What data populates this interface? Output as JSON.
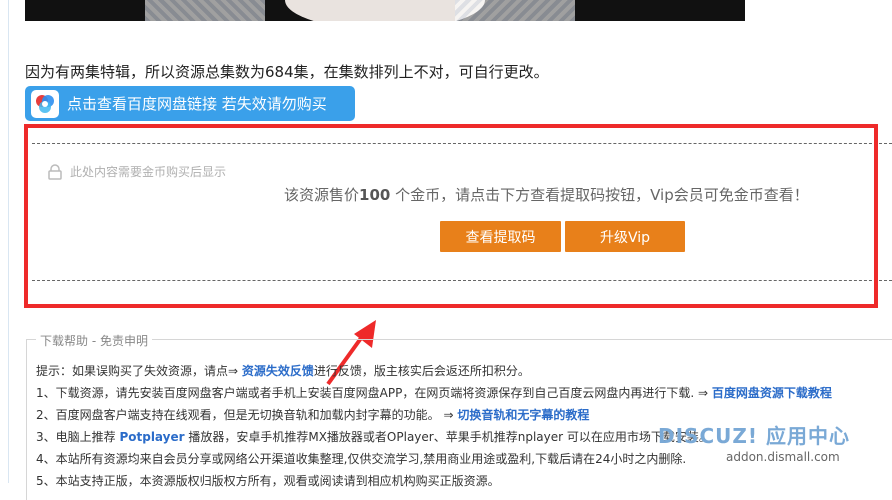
{
  "notice_text": "因为有两集特辑，所以资源总集数为684集，在集数排列上不对，可自行更改。",
  "pan_button": {
    "label": "点击查看百度网盘链接  若失效请勿购买"
  },
  "locked": {
    "hint": "此处内容需要金币购买后显示",
    "sale_prefix": "该资源售价",
    "price": "100",
    "sale_suffix": " 个金币，请点击下方查看提取码按钮，Vip会员可免金币查看！",
    "view_code_button": "查看提取码",
    "upgrade_vip_button": "升级Vip"
  },
  "help": {
    "legend": "下载帮助 - 免责申明",
    "lines": [
      {
        "pre": "提示：如果误购买了失效资源，请点⇒ ",
        "link": "资源失效反馈",
        "post": "进行反馈，版主核实后会返还所扣积分。"
      },
      {
        "pre": "1、下载资源，请先安装百度网盘客户端或者手机上安装百度网盘APP，在网页端将资源保存到自己百度云网盘内再进行下载. ⇒ ",
        "link": "百度网盘资源下载教程",
        "post": ""
      },
      {
        "pre": "2、百度网盘客户端支持在线观看，但是无切换音轨和加载内封字幕的功能。 ⇒ ",
        "link": "切换音轨和无字幕的教程",
        "post": ""
      },
      {
        "pre": "3、电脑上推荐 ",
        "link": "Potplayer",
        "post": " 播放器，安卓手机推荐MX播放器或者OPlayer、苹果手机推荐nplayer 可以在应用市场下载安装。"
      },
      {
        "pre": "4、本站所有资源均来自会员分享或网络公开渠道收集整理,仅供交流学习,禁用商业用途或盈利,下载后请在24小时之内删除.",
        "link": "",
        "post": ""
      },
      {
        "pre": "5、本站支持正版，本资源版权归版权方所有，观看或阅读请到相应机构购买正版资源。",
        "link": "",
        "post": ""
      }
    ]
  },
  "watermark": {
    "brand": "DISCUZ! 应用中心",
    "url": "addon.dismall.com"
  },
  "colors": {
    "accent_blue": "#3aa0ea",
    "orange": "#e8801a",
    "highlight_red": "#ee2a2a",
    "link_blue": "#2b6cc9"
  },
  "icons": {
    "pan_logo": "baidu-netdisk-icon",
    "lock": "lock-icon",
    "arrow": "red-arrow-icon"
  }
}
